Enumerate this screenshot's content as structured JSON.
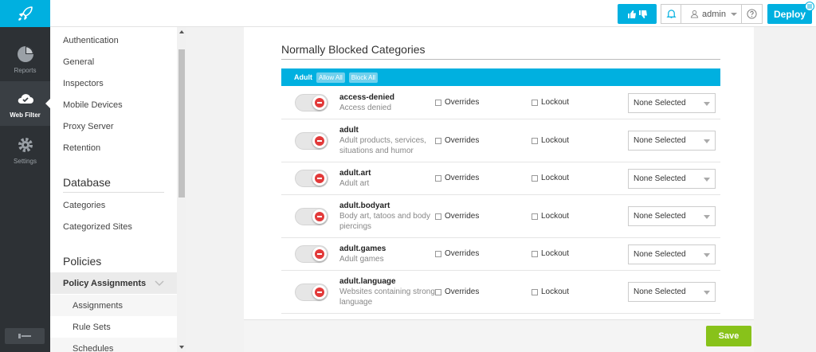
{
  "rail": {
    "items": [
      {
        "label": "Reports",
        "icon": "pie-chart-icon"
      },
      {
        "label": "Web Filter",
        "icon": "cloud-check-icon",
        "active": true
      },
      {
        "label": "Settings",
        "icon": "gear-icon"
      }
    ]
  },
  "topbar": {
    "user": "admin",
    "deploy_label": "Deploy"
  },
  "sidebar": {
    "items_top": [
      "Authentication",
      "General",
      "Inspectors",
      "Mobile Devices",
      "Proxy Server",
      "Retention"
    ],
    "database_heading": "Database",
    "database_items": [
      "Categories",
      "Categorized Sites"
    ],
    "policies_heading": "Policies",
    "policy_group": "Policy Assignments",
    "policy_sub": [
      "Assignments",
      "Rule Sets",
      "Schedules"
    ]
  },
  "main": {
    "title": "Normally Blocked Categories",
    "category_bar": {
      "label": "Adult",
      "allow_all": "Allow All",
      "block_all": "Block All"
    },
    "overrides_label": "Overrides",
    "lockout_label": "Lockout",
    "rows": [
      {
        "name": "access-denied",
        "desc": "Access denied",
        "select": "None Selected"
      },
      {
        "name": "adult",
        "desc": "Adult products, services, situations and humor",
        "select": "None Selected"
      },
      {
        "name": "adult.art",
        "desc": "Adult art",
        "select": "None Selected"
      },
      {
        "name": "adult.bodyart",
        "desc": "Body art, tatoos and body piercings",
        "select": "None Selected"
      },
      {
        "name": "adult.games",
        "desc": "Adult games",
        "select": "None Selected"
      },
      {
        "name": "adult.language",
        "desc": "Websites containing strong language",
        "select": "None Selected"
      }
    ],
    "save_label": "Save"
  },
  "colors": {
    "accent": "#00b0e0",
    "save": "#88c21a",
    "rail_bg": "#2d3135",
    "toggle_off": "#e23a3a"
  }
}
